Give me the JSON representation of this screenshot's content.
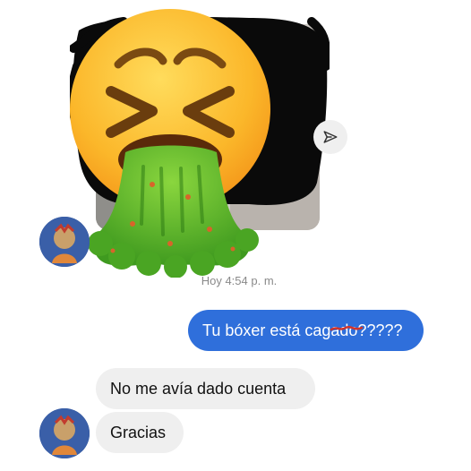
{
  "chat": {
    "timestamp": "Hoy 4:54 p. m.",
    "messages": [
      {
        "side": "sent",
        "text": "Tu bóxer está cagado?????"
      },
      {
        "side": "received",
        "text": "No me avía dado cuenta"
      },
      {
        "side": "received",
        "text": "Gracias"
      }
    ]
  },
  "icons": {
    "share": "paper-plane-icon",
    "overlay": "vomiting-face-emoji"
  },
  "colors": {
    "sent_bubble": "#2f6fdb",
    "received_bubble": "#efefef",
    "emoji_yellow": "#fbb72a",
    "vomit_green": "#58b92c"
  }
}
